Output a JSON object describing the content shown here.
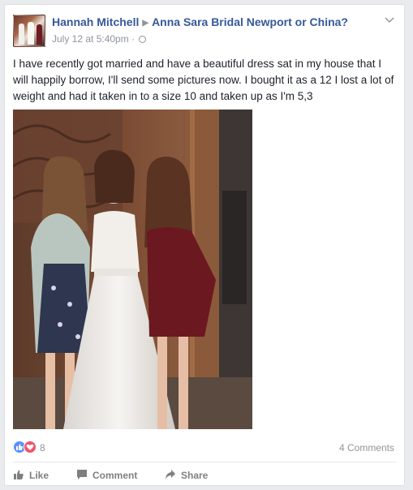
{
  "post": {
    "author": "Hannah Mitchell",
    "group": "Anna Sara Bridal Newport or China?",
    "timestamp": "July 12 at 5:40pm",
    "separator": "·",
    "text": "I have recently got married and have a beautiful dress sat in my house that I will happily borrow, I'll send some pictures now. I bought it as a 12 I lost a lot of weight and had it taken in to a size 10 and taken up as I'm 5,3"
  },
  "footer": {
    "reaction_count": "8",
    "comments_label": "4 Comments",
    "actions": {
      "like": "Like",
      "comment": "Comment",
      "share": "Share"
    }
  },
  "colors": {
    "link": "#365899",
    "like_blue": "#5890ff",
    "love_red": "#f25268",
    "muted": "#90949c"
  },
  "icons": [
    "like-reaction-icon",
    "love-reaction-icon",
    "thumbs-up-icon",
    "comment-icon",
    "share-icon",
    "globe-icon",
    "chevron-down-icon",
    "triangle-arrow-icon"
  ]
}
